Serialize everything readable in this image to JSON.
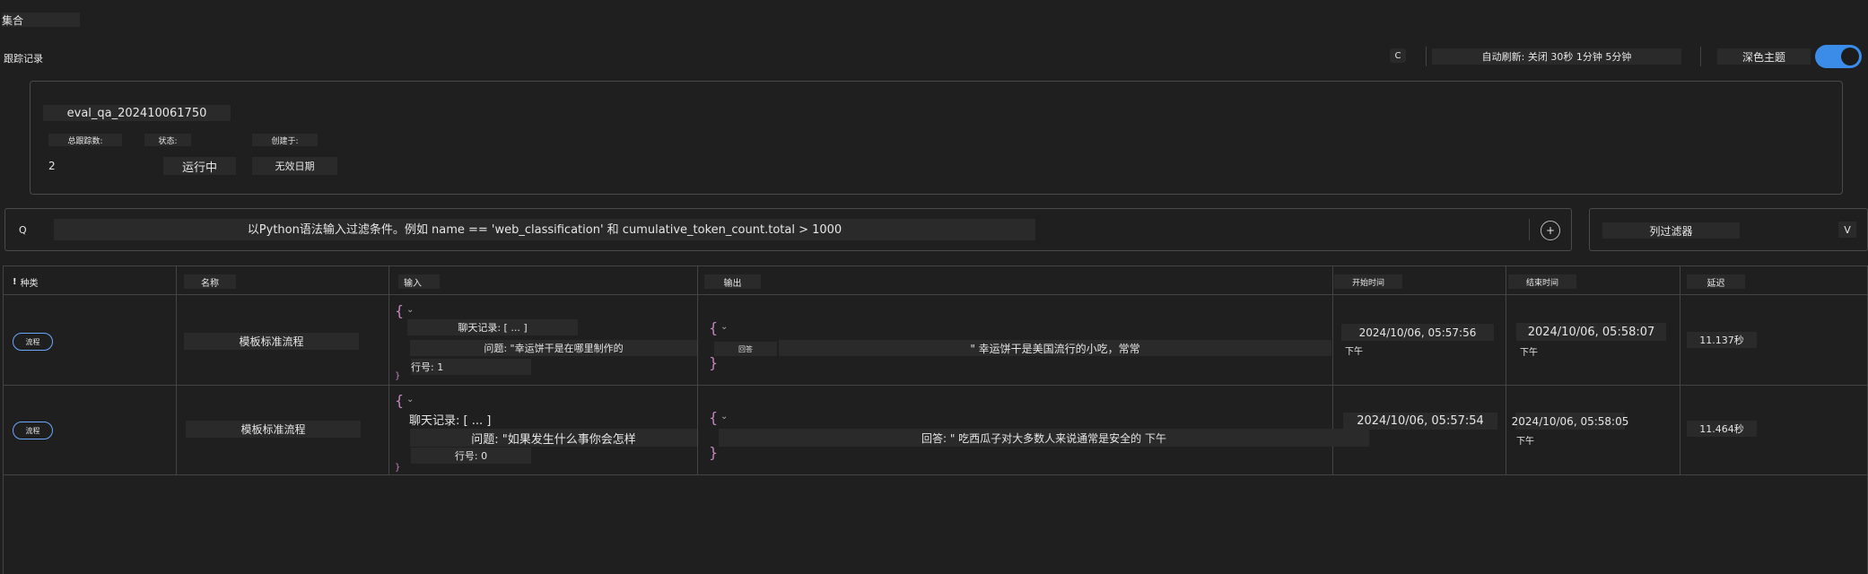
{
  "header": {
    "title": "集合",
    "subtitle": "跟踪记录",
    "refresh_icon": "refresh-icon",
    "refresh_glyph": "C",
    "auto_refresh": "自动刷新: 关闭 30秒 1分钟 5分钟",
    "theme_label": "深色主题",
    "theme_on": true,
    "accent_color": "#3b8ce8"
  },
  "summary": {
    "run_name": "eval_qa_202410061750",
    "total_label": "总跟踪数:",
    "total_value": "2",
    "status_label": "状态:",
    "status_value": "运行中",
    "created_label": "创建于:",
    "created_value": "无效日期"
  },
  "filter": {
    "icon_glyph": "Q",
    "placeholder": "以Python语法输入过滤条件。例如 name == 'web_classification' 和 cumulative_token_count.total > 1000",
    "add_glyph": "+",
    "column_filter_label": "列过滤器",
    "column_filter_glyph": "V"
  },
  "table": {
    "columns": [
      "种类",
      "名称",
      "输入",
      "输出",
      "开始时间",
      "结束时间",
      "延迟"
    ],
    "kind_marker": "!",
    "rows": [
      {
        "kind": "流程",
        "name": "模板标准流程",
        "input_open": "{",
        "input_line1": "聊天记录: [ ... ]",
        "input_line2": "问题: \"幸运饼干是在哪里制作的",
        "input_line3": "行号: 1",
        "input_close": "}",
        "output_open": "{",
        "output_key": "回答",
        "output_line1": "\" 幸运饼干是美国流行的小吃，常常",
        "output_close": "}",
        "start_date": "2024/10/06, 05:57:56",
        "start_ampm": "下午",
        "end_date": "2024/10/06, 05:58:07",
        "end_ampm": "下午",
        "latency": "11.137秒"
      },
      {
        "kind": "流程",
        "name": "模板标准流程",
        "input_open": "{",
        "input_line1": "聊天记录: [ ... ]",
        "input_line2": "问题: \"如果发生什么事你会怎样",
        "input_line3": "行号: 0",
        "input_close": "}",
        "output_open": "{",
        "output_line1": "回答: \" 吃西瓜子对大多数人来说通常是安全的 下午",
        "output_close": "}",
        "start_date": "2024/10/06, 05:57:54",
        "start_ampm": "",
        "end_date": "2024/10/06, 05:58:05",
        "end_ampm": "下午",
        "latency": "11.464秒"
      }
    ]
  }
}
